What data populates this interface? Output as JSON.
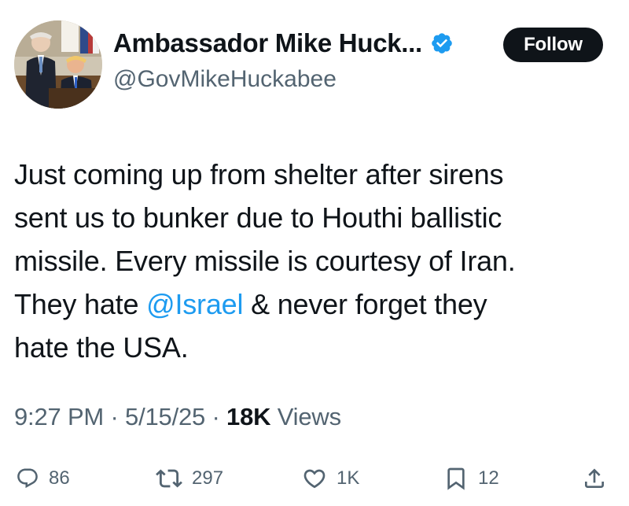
{
  "author": {
    "display_name": "Ambassador Mike Huck...",
    "handle": "@GovMikeHuckabee",
    "verified": true
  },
  "follow_button_label": "Follow",
  "tweet": {
    "text_before_mention": "Just coming up from shelter after sirens\nsent us to bunker due to Houthi ballistic\nmissile. Every missile is courtesy of Iran.\nThey hate ",
    "mention": "@Israel",
    "text_after_mention": " & never forget they\nhate the USA."
  },
  "meta": {
    "time": "9:27 PM",
    "separator": "·",
    "date": "5/15/25",
    "views_count": "18K",
    "views_label": "Views"
  },
  "actions": {
    "replies": "86",
    "reposts": "297",
    "likes": "1K",
    "bookmarks": "12"
  },
  "icons": {
    "verified": "verified-badge-icon",
    "reply": "reply-icon",
    "repost": "repost-icon",
    "like": "heart-icon",
    "bookmark": "bookmark-icon",
    "share": "share-icon"
  },
  "colors": {
    "text": "#0f1419",
    "secondary": "#536471",
    "accent": "#1d9bf0",
    "follow_bg": "#0f1419"
  }
}
